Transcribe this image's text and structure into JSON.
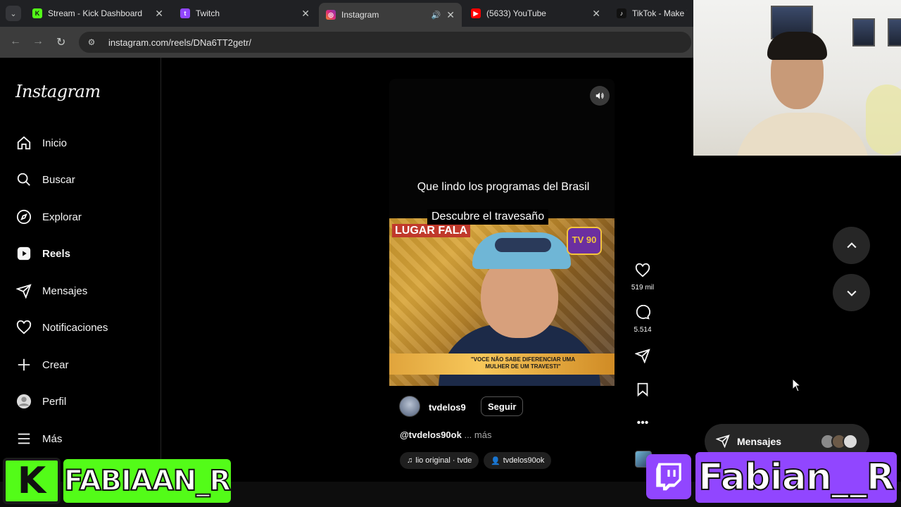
{
  "browser": {
    "tabs": [
      {
        "title": "Stream - Kick Dashboard",
        "favicon": "kick-icon",
        "color": "#53fc18"
      },
      {
        "title": "Twitch",
        "favicon": "twitch-icon",
        "color": "#9146ff"
      },
      {
        "title": "Instagram",
        "favicon": "instagram-icon",
        "color": "#e1306c",
        "active": true
      },
      {
        "title": "(5633) YouTube",
        "favicon": "youtube-icon",
        "color": "#ff0000"
      },
      {
        "title": "TikTok - Make You",
        "favicon": "tiktok-icon",
        "color": "#000000"
      }
    ],
    "url": "instagram.com/reels/DNa6TT2getr/"
  },
  "sidebar": {
    "logo": "Instagram",
    "items": [
      {
        "label": "Inicio",
        "icon": "home-icon"
      },
      {
        "label": "Buscar",
        "icon": "search-icon"
      },
      {
        "label": "Explorar",
        "icon": "compass-icon"
      },
      {
        "label": "Reels",
        "icon": "reels-icon",
        "active": true
      },
      {
        "label": "Mensajes",
        "icon": "send-icon"
      },
      {
        "label": "Notificaciones",
        "icon": "heart-icon"
      },
      {
        "label": "Crear",
        "icon": "plus-icon"
      },
      {
        "label": "Perfil",
        "icon": "avatar-icon"
      },
      {
        "label": "Más",
        "icon": "menu-icon"
      }
    ]
  },
  "reel": {
    "caption_top": "Que lindo los programas del Brasil",
    "caption_second": "Descubre el travesaño",
    "video_logo_left": "LUGAR FALA",
    "video_logo_right": "TV 90",
    "lower_third": "\"VOCE NÃO SABE DIFERENCIAR UMA MULHER DE UM TRAVESTI\"",
    "author": "tvdelos9",
    "follow_label": "Seguir",
    "description": "@tvdelos90ok",
    "more_label": "... más",
    "audio_label": "lio original · tvde",
    "tag_label": "tvdelos90ok"
  },
  "actions": {
    "likes": "519 mil",
    "comments": "5.514"
  },
  "messages": {
    "label": "Mensajes"
  },
  "overlays": {
    "kick_letter": "K",
    "kick_name": "FABIAAN_R",
    "twitch_name": "Fabian__R"
  },
  "colors": {
    "kick_green": "#53fc18",
    "twitch_purple": "#9146ff",
    "instagram_bg": "#000000"
  }
}
